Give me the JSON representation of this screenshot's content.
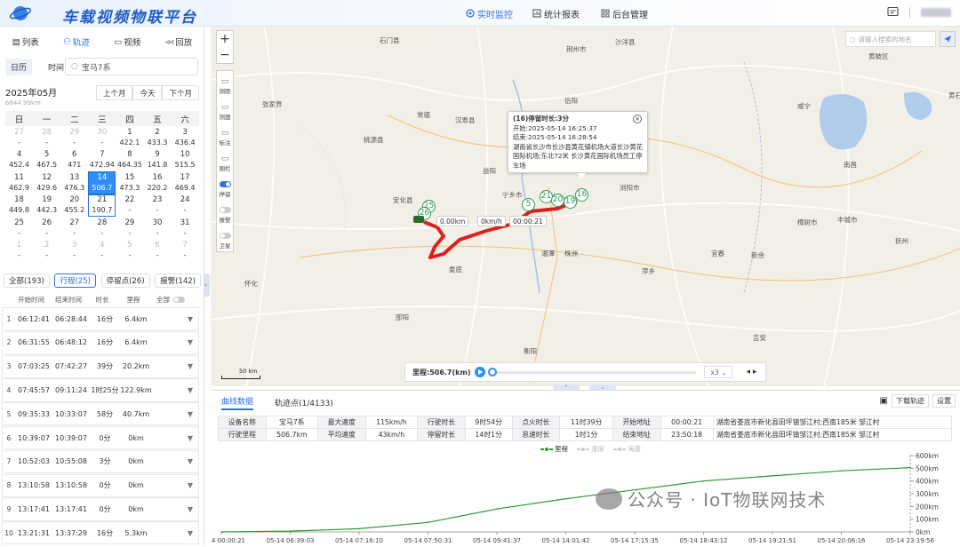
{
  "header": {
    "title": "车载视频物联平台",
    "nav": [
      {
        "label": "实时监控",
        "active": true
      },
      {
        "label": "统计报表",
        "active": false
      },
      {
        "label": "后台管理",
        "active": false
      }
    ]
  },
  "left": {
    "tabs": [
      {
        "label": "列表",
        "active": false
      },
      {
        "label": "轨迹",
        "active": true
      },
      {
        "label": "视频",
        "active": false
      },
      {
        "label": "回放",
        "active": false
      }
    ],
    "subtabs": [
      {
        "label": "日历",
        "active": true
      },
      {
        "label": "时间",
        "active": false
      }
    ],
    "vehicle": "宝马7系",
    "calendar": {
      "month": "2025年05月",
      "sub": "6844.99km",
      "buttons": [
        "上个月",
        "今天",
        "下个月"
      ],
      "dow": [
        "日",
        "一",
        "二",
        "三",
        "四",
        "五",
        "六"
      ],
      "days": [
        {
          "d": "27",
          "v": "-",
          "other": true
        },
        {
          "d": "28",
          "v": "-",
          "other": true
        },
        {
          "d": "29",
          "v": "-",
          "other": true
        },
        {
          "d": "30",
          "v": "-",
          "other": true
        },
        {
          "d": "1",
          "v": "422.1"
        },
        {
          "d": "2",
          "v": "433.3"
        },
        {
          "d": "3",
          "v": "436.4"
        },
        {
          "d": "4",
          "v": "452.4"
        },
        {
          "d": "5",
          "v": "467.5"
        },
        {
          "d": "6",
          "v": "471"
        },
        {
          "d": "7",
          "v": "472.94"
        },
        {
          "d": "8",
          "v": "464.35"
        },
        {
          "d": "9",
          "v": "141.8"
        },
        {
          "d": "10",
          "v": "515.5"
        },
        {
          "d": "11",
          "v": "462.9"
        },
        {
          "d": "12",
          "v": "429.6"
        },
        {
          "d": "13",
          "v": "476.3"
        },
        {
          "d": "14",
          "v": "506.7",
          "sel": true
        },
        {
          "d": "15",
          "v": "473.3"
        },
        {
          "d": "16",
          "v": "220.2"
        },
        {
          "d": "17",
          "v": "469.4"
        },
        {
          "d": "18",
          "v": "449.8"
        },
        {
          "d": "19",
          "v": "442.3"
        },
        {
          "d": "20",
          "v": "455.2"
        },
        {
          "d": "21",
          "v": "190.7",
          "sel2": true
        },
        {
          "d": "22",
          "v": "-"
        },
        {
          "d": "23",
          "v": "-"
        },
        {
          "d": "24",
          "v": "-"
        },
        {
          "d": "25",
          "v": "-"
        },
        {
          "d": "26",
          "v": "-"
        },
        {
          "d": "27",
          "v": "-"
        },
        {
          "d": "28",
          "v": "-"
        },
        {
          "d": "29",
          "v": "-"
        },
        {
          "d": "30",
          "v": "-"
        },
        {
          "d": "31",
          "v": "-"
        },
        {
          "d": "1",
          "v": "-",
          "other": true
        },
        {
          "d": "2",
          "v": "-",
          "other": true
        },
        {
          "d": "3",
          "v": "-",
          "other": true
        },
        {
          "d": "4",
          "v": "-",
          "other": true
        },
        {
          "d": "5",
          "v": "-",
          "other": true
        },
        {
          "d": "6",
          "v": "-",
          "other": true
        },
        {
          "d": "7",
          "v": "-",
          "other": true
        }
      ]
    },
    "filters": [
      {
        "label": "全部(193)",
        "active": false
      },
      {
        "label": "行程(25)",
        "active": true
      },
      {
        "label": "停留点(26)",
        "active": false
      },
      {
        "label": "报警(142)",
        "active": false
      }
    ],
    "table_headers": [
      "开始时间",
      "结束时间",
      "时长",
      "里程",
      "全部"
    ],
    "rows": [
      {
        "n": "1",
        "start": "06:12:41",
        "end": "06:28:44",
        "dur": "16分",
        "km": "6.4km"
      },
      {
        "n": "2",
        "start": "06:31:55",
        "end": "06:48:12",
        "dur": "16分",
        "km": "6.4km"
      },
      {
        "n": "3",
        "start": "07:03:25",
        "end": "07:42:27",
        "dur": "39分",
        "km": "20.2km"
      },
      {
        "n": "4",
        "start": "07:45:57",
        "end": "09:11:24",
        "dur": "1时25分",
        "km": "122.9km"
      },
      {
        "n": "5",
        "start": "09:35:33",
        "end": "10:33:07",
        "dur": "58分",
        "km": "40.7km"
      },
      {
        "n": "6",
        "start": "10:39:07",
        "end": "10:39:07",
        "dur": "0分",
        "km": "0km"
      },
      {
        "n": "7",
        "start": "10:52:03",
        "end": "10:55:08",
        "dur": "3分",
        "km": "0km"
      },
      {
        "n": "8",
        "start": "13:10:58",
        "end": "13:10:58",
        "dur": "0分",
        "km": "0km"
      },
      {
        "n": "9",
        "start": "13:17:41",
        "end": "13:17:41",
        "dur": "0分",
        "km": "0km"
      },
      {
        "n": "10",
        "start": "13:21:31",
        "end": "13:37:29",
        "dur": "16分",
        "km": "5.3km"
      }
    ]
  },
  "map": {
    "search_placeholder": "请输入搜索的地名",
    "tools": [
      "测距",
      "测面",
      "标注",
      "围栏",
      "停留",
      "报警",
      "卫星"
    ],
    "popup": {
      "title": "(16)停留时长:3分",
      "start": "开始:2025-05-14 16:25:37",
      "end": "结束:2025-05-14 16:28:54",
      "address": "湖南省长沙市长沙县黄花镇机场大道长沙黄花国际机场;东北72米 长沙黄花国际机场员工停车场"
    },
    "labels": {
      "distance": "0.00km",
      "speed": "0km/h",
      "time": "00:00:21"
    },
    "scale": "50 km",
    "markers": [
      "25",
      "26",
      "5",
      "21",
      "20",
      "19",
      "16"
    ],
    "cities": [
      {
        "t": "石门县",
        "x": 190,
        "y": 10
      },
      {
        "t": "荆州市",
        "x": 400,
        "y": 20
      },
      {
        "t": "沙洋县",
        "x": 455,
        "y": 12
      },
      {
        "t": "黄陂区",
        "x": 740,
        "y": 28
      },
      {
        "t": "张家界",
        "x": 58,
        "y": 82
      },
      {
        "t": "常德",
        "x": 232,
        "y": 94
      },
      {
        "t": "汉寿县",
        "x": 275,
        "y": 100
      },
      {
        "t": "岳阳",
        "x": 398,
        "y": 78
      },
      {
        "t": "咸宁",
        "x": 660,
        "y": 84
      },
      {
        "t": "黄石",
        "x": 830,
        "y": 72
      },
      {
        "t": "桃源县",
        "x": 172,
        "y": 122
      },
      {
        "t": "南昌",
        "x": 712,
        "y": 150
      },
      {
        "t": "益阳",
        "x": 306,
        "y": 157
      },
      {
        "t": "宁乡市",
        "x": 328,
        "y": 184
      },
      {
        "t": "长沙",
        "x": 378,
        "y": 186
      },
      {
        "t": "安化县",
        "x": 205,
        "y": 190
      },
      {
        "t": "浏阳市",
        "x": 460,
        "y": 176
      },
      {
        "t": "宜春",
        "x": 563,
        "y": 250
      },
      {
        "t": "新余",
        "x": 608,
        "y": 252
      },
      {
        "t": "抚州",
        "x": 770,
        "y": 236
      },
      {
        "t": "娄底",
        "x": 268,
        "y": 268
      },
      {
        "t": "湘潭",
        "x": 372,
        "y": 250
      },
      {
        "t": "株洲",
        "x": 398,
        "y": 250
      },
      {
        "t": "萍乡",
        "x": 485,
        "y": 270
      },
      {
        "t": "怀化",
        "x": 38,
        "y": 284
      },
      {
        "t": "邵阳",
        "x": 208,
        "y": 322
      },
      {
        "t": "衡阳",
        "x": 352,
        "y": 360
      },
      {
        "t": "吉安",
        "x": 610,
        "y": 345
      },
      {
        "t": "丰城市",
        "x": 705,
        "y": 212
      },
      {
        "t": "樟树市",
        "x": 660,
        "y": 215
      }
    ],
    "playbar": {
      "mileage": "里程:506.7(km)",
      "speed": "x3"
    }
  },
  "bottom": {
    "tabs": [
      {
        "label": "曲线数据",
        "active": true
      },
      {
        "label": "轨迹点(1/4133)",
        "active": false
      }
    ],
    "actions": [
      "下载轨迹",
      "设置"
    ],
    "stats": [
      [
        "设备名称",
        "宝马7系",
        "最大速度",
        "115km/h",
        "行驶时长",
        "9时54分",
        "点火时长",
        "11时39分",
        "开始地址",
        "00:00:21",
        "湖南省娄底市新化县田坪镇邹江村;西南185米 邹江村"
      ],
      [
        "行驶里程",
        "506.7km",
        "平均速度",
        "43km/h",
        "停留时长",
        "14时1分",
        "怠速时长",
        "1时1分",
        "结束地址",
        "23:50:18",
        "湖南省娄底市新化县田坪镇邹江村;西南185米 邹江村"
      ]
    ],
    "legend": [
      {
        "label": "里程",
        "on": true
      },
      {
        "label": "速度",
        "on": false
      },
      {
        "label": "海拔",
        "on": false
      }
    ]
  },
  "chart_data": {
    "type": "line",
    "x": [
      "05-14 00:00:21",
      "05-14 06:39:03",
      "05-14 07:16:10",
      "05-14 07:50:31",
      "05-14 09:41:37",
      "05-14 14:01:42",
      "05-14 17:15:35",
      "05-14 18:43:12",
      "05-14 19:21:51",
      "05-14 20:06:16",
      "05-14 23:19:56"
    ],
    "series": [
      {
        "name": "里程",
        "values": [
          0,
          6,
          25,
          75,
          180,
          260,
          330,
          400,
          440,
          480,
          505
        ]
      }
    ],
    "y_ticks": [
      "0km",
      "100km",
      "200km",
      "300km",
      "400km",
      "500km",
      "600km"
    ],
    "ylim": [
      0,
      600
    ],
    "color": "#2b9a2b"
  },
  "watermark": "公众号 · IoT物联网技术"
}
